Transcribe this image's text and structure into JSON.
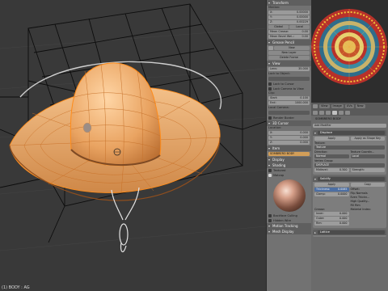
{
  "viewport": {
    "footer_text": "(1) BODY : AG"
  },
  "props": {
    "transform": {
      "header": "Transform",
      "median_label": "Median:",
      "x": {
        "axis": "X:",
        "value": "0.00000"
      },
      "y": {
        "axis": "Y:",
        "value": "0.00000"
      },
      "z": {
        "axis": "Z:",
        "value": "0.00229"
      },
      "global_label": "Global",
      "local_label": "Local",
      "mean_crease": {
        "label": "Mean Crease:",
        "value": "0.00"
      },
      "mean_bevel": {
        "label": "Mean Bevel Wei..:",
        "value": "0.00"
      }
    },
    "grease_pencil": {
      "header": "Grease Pencil",
      "new_label": "New",
      "new_layer_label": "New Layer",
      "delete_frame_label": "Delete Frame"
    },
    "view": {
      "header": "View",
      "lens": {
        "label": "Lens:",
        "value": "35.000"
      },
      "lock_to_object_label": "Lock to Object:",
      "lock_to_cursor_label": "Lock to Cursor",
      "lock_camera_label": "Lock Camera to View",
      "clip_label": "Clip:",
      "start": {
        "label": "Start:",
        "value": "0.100"
      },
      "end": {
        "label": "End:",
        "value": "1000.000"
      },
      "local_camera_label": "Local Camera:",
      "render_border_label": "Render Border"
    },
    "cursor": {
      "header": "3D Cursor",
      "location_label": "Location:",
      "x": {
        "axis": "X:",
        "value": "0.000"
      },
      "y": {
        "axis": "Y:",
        "value": "0.000"
      },
      "z": {
        "axis": "Z:",
        "value": "0.000"
      }
    },
    "item": {
      "header": "Item",
      "name": "SOMBRERO BODY"
    },
    "display_header": "Display",
    "shading": {
      "header": "Shading",
      "textured_label": "Textured",
      "matcap_label": "Matcap",
      "backface_label": "Backface Culling",
      "hidden_wire_label": "Hidden Wire",
      "motion_label": "Motion Tracking",
      "mesh_display_label": "Mesh Display"
    }
  },
  "right": {
    "toolbar": {
      "view_label": "View",
      "image_label": "Image",
      "uvs_label": "UVs",
      "new_label": "New"
    },
    "object_name": "SOMBRERO BODY",
    "add_modifier_label": "Add Modifier",
    "displace": {
      "name": "Displace",
      "apply_label": "Apply",
      "apply_shape_label": "Apply as Shape Key",
      "texture_label": "Texture:",
      "texture_value": "Texture",
      "direction_label": "Direction:",
      "direction_value": "Normal",
      "texture_coords_label": "Texture Coordin...",
      "texture_coords_value": "Local",
      "vertex_group_label": "Vertex Group:",
      "vertex_group_value": "DISPLACE",
      "midlevel": {
        "label": "Midlevel:",
        "value": "0.500"
      },
      "strength_label": "Strength:"
    },
    "solidify": {
      "name": "Solidify",
      "apply_label": "Apply",
      "copy_label": "Copy",
      "thickness": {
        "label": "Thickness:",
        "value": "0.0065"
      },
      "clamp": {
        "label": "Clamp:",
        "value": "0.0000"
      },
      "offset_label": "Offset:",
      "flip_label": "Flip Normals",
      "even_label": "Even Thickn...",
      "high_quality_label": "High Quality...",
      "fill_rim_label": "Fill Rim",
      "crease_label": "Crease:",
      "inner": {
        "label": "Inner:",
        "value": "0.000"
      },
      "outer": {
        "label": "Outer:",
        "value": "0.000"
      },
      "rim": {
        "label": "Rim:",
        "value": "0.000"
      },
      "material_index_label": "Material Index:"
    },
    "lattice": {
      "name": "Lattice"
    }
  },
  "colors": {
    "viewport_bg": "#393939",
    "mesh_orange": "#e8a35c",
    "selection_orange": "#ff8c1a",
    "panel_bg": "#727272",
    "uv_red": "#c0341a"
  }
}
